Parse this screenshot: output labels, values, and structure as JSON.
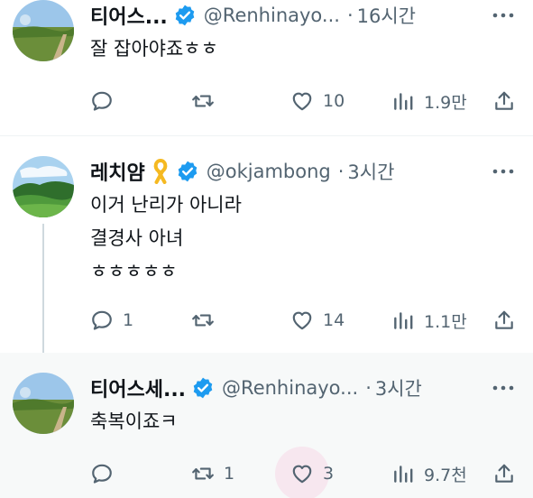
{
  "tweets": [
    {
      "name": "티어스...",
      "handle": "@Renhinayo...",
      "separator": "·",
      "time": "16시간",
      "text": "잘 잡아야죠ㅎㅎ",
      "avatar_icon": "landscape-riverbank-avatar",
      "actions": {
        "reply": "",
        "retweet": "",
        "like": "10",
        "views": "1.9만"
      }
    },
    {
      "name": "레치얌",
      "handle": "@okjambong",
      "separator": "·",
      "time": "3시간",
      "text": "이거 난리가 아니라\n결경사 아녀\nㅎㅎㅎㅎㅎ",
      "avatar_icon": "landscape-hills-avatar",
      "name_badge_icon": "yellow-ribbon-icon",
      "actions": {
        "reply": "1",
        "retweet": "",
        "like": "14",
        "views": "1.1만"
      }
    },
    {
      "name": "티어스세...",
      "handle": "@Renhinayo...",
      "separator": "·",
      "time": "3시간",
      "text": "축복이죠ㅋ",
      "avatar_icon": "landscape-riverbank-avatar",
      "actions": {
        "reply": "",
        "retweet": "1",
        "like": "3",
        "views": "9.7천"
      }
    }
  ],
  "colors": {
    "verified": "#1d9bf0",
    "icon": "#536471",
    "text": "#0f1419",
    "divider": "#eff3f4",
    "highlight_bg": "#f7f9f9",
    "like_hover": "#f91880"
  }
}
